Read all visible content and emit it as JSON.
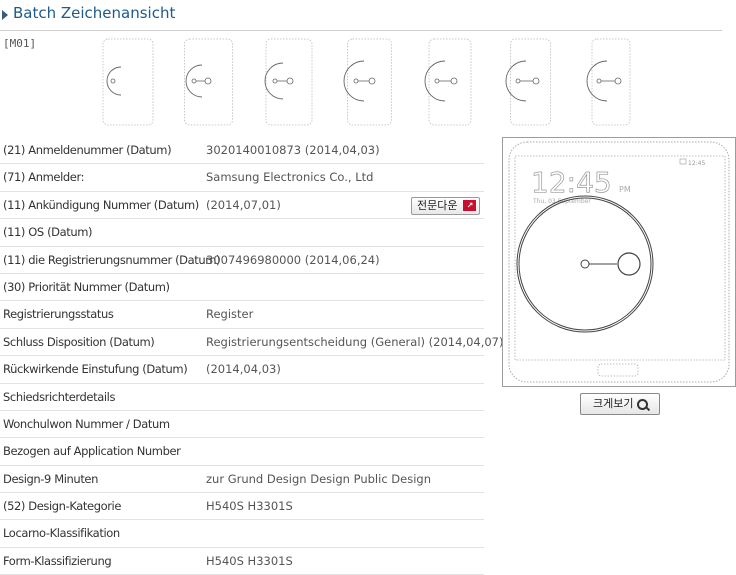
{
  "page": {
    "title": "Batch Zeichenansicht"
  },
  "gallery": {
    "code": "[M01]",
    "thumbnail_count": 7
  },
  "details": [
    {
      "label": "(21) Anmeldenummer (Datum)",
      "value": "3020140010873 (2014,04,03)"
    },
    {
      "label": "(71) Anmelder:",
      "value": "Samsung Electronics Co., Ltd"
    },
    {
      "label": "(11) Ankündigung Nummer (Datum)",
      "value": "(2014,07,01)"
    },
    {
      "label": "(11) OS (Datum)",
      "value": ""
    },
    {
      "label": "(11) die Registrierungsnummer (Datum)",
      "value": "3007496980000 (2014,06,24)"
    },
    {
      "label": "(30) Priorität Nummer (Datum)",
      "value": ""
    },
    {
      "label": "Registrierungsstatus",
      "value": "Register"
    },
    {
      "label": "Schluss Disposition (Datum)",
      "value": "Registrierungsentscheidung (General) (2014,04,07)"
    },
    {
      "label": "Rückwirkende Einstufung (Datum)",
      "value": "(2014,04,03)"
    },
    {
      "label": "Schiedsrichterdetails",
      "value": ""
    },
    {
      "label": "Wonchulwon Nummer / Datum",
      "value": ""
    },
    {
      "label": "Bezogen auf Application Number",
      "value": ""
    },
    {
      "label": "Design-9 Minuten",
      "value": "zur Grund Design Design Public Design"
    },
    {
      "label": "(52) Design-Kategorie",
      "value": "H540S  H3301S"
    },
    {
      "label": "Locarno-Klassifikation",
      "value": ""
    },
    {
      "label": "Form-Klassifizierung",
      "value": "H540S  H3301S"
    }
  ],
  "download_button": {
    "label": "전문다운",
    "icon": "pdf-icon"
  },
  "preview": {
    "clock": "12:45",
    "ampm": "PM",
    "date": "Thu, 03 September",
    "status_time": "12:45"
  },
  "zoom_button": {
    "label": "크게보기",
    "icon": "magnifier-icon"
  },
  "colors": {
    "title": "#1e5a8a",
    "line_art": "#555555",
    "border": "#9c9c9c"
  }
}
